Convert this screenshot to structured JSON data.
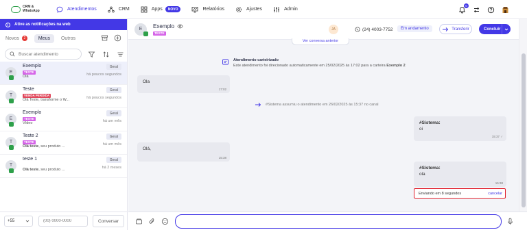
{
  "brand": {
    "line1": "CRM &",
    "line2": "WhatsApp"
  },
  "nav": [
    {
      "label": "Atendimentos",
      "icon": "chat-bubble-icon",
      "active": true
    },
    {
      "label": "CRM",
      "icon": "crm-nodes-icon"
    },
    {
      "label": "Apps",
      "icon": "apps-grid-icon",
      "badge": "NOVO"
    },
    {
      "label": "Relatórios",
      "icon": "reports-icon"
    },
    {
      "label": "Ajustes",
      "icon": "gear-icon"
    },
    {
      "label": "Admin",
      "icon": "sliders-icon"
    }
  ],
  "notifications_count": "0",
  "notif_bar": "Ative as notificações na web",
  "tabs": {
    "novos": "Novos",
    "novos_count": "2",
    "meus": "Meus",
    "outros": "Outros"
  },
  "search": {
    "placeholder": "Buscar atendimento"
  },
  "conversations": [
    {
      "initial": "E",
      "name": "Exemplo",
      "tag": "TESTE",
      "tag_kind": "teste",
      "preview": "Olá",
      "preview_bold": "",
      "queue": "Geral",
      "time": "há poucos segundos",
      "selected": true
    },
    {
      "initial": "T",
      "name": "Teste",
      "tag": "VENDA PERDIDA",
      "tag_kind": "venda",
      "preview": "Olá Teste, transforme o W...",
      "preview_bold": "",
      "queue": "Geral",
      "time": "há poucos segundos"
    },
    {
      "initial": "E",
      "name": "Exemplo",
      "tag": "TESTE",
      "tag_kind": "teste",
      "preview": "Vídeo",
      "preview_bold": "",
      "queue": "Geral",
      "time": "há um mês"
    },
    {
      "initial": "T",
      "name": "Teste 2",
      "tag": "TESTE",
      "tag_kind": "teste",
      "preview": ", seu produto ...",
      "preview_bold": "Olá teste",
      "queue": "Geral",
      "time": "há um mês"
    },
    {
      "initial": "T",
      "name": "teste 1",
      "tag": "",
      "tag_kind": "",
      "preview": ", seu produto ...",
      "preview_bold": "Olá teste",
      "queue": "Geral",
      "time": "há 2 meses"
    }
  ],
  "bottom_left": {
    "ddi": "+55",
    "phone_placeholder": "(00) 0000-0000",
    "button": "Conversar"
  },
  "chat": {
    "initial": "E",
    "name": "Exemplo",
    "tag": "TESTE",
    "agent_initials": "JA",
    "phone": "(24) 4003-7752",
    "status": "Em andamento",
    "transfer": "Transferir",
    "conclude": "Concluir",
    "older": "Ver conversa anterior",
    "carteira_title": "Atendimento carteirizado",
    "carteira_text_pre": "Este atendimento foi direcionado automaticamente em 25/02/2025 às 17:02 para a carteira ",
    "carteira_name": "Exemplo 2",
    "divider": "#Sistema assumiu o atendimento em 26/02/2025 às 15:37 no canal",
    "messages": [
      {
        "text": "Ola",
        "time": "17:02"
      },
      {
        "sender": "#Sistema:",
        "text": "oi",
        "time": "15:37"
      },
      {
        "text": "Olá,",
        "time": "15:38"
      },
      {
        "sender": "#Sistema:",
        "text": "ola",
        "time": "15:38"
      }
    ],
    "pending": "Enviando em 8 segundos",
    "cancel": "cancelar"
  },
  "composer": {
    "placeholder": ""
  }
}
